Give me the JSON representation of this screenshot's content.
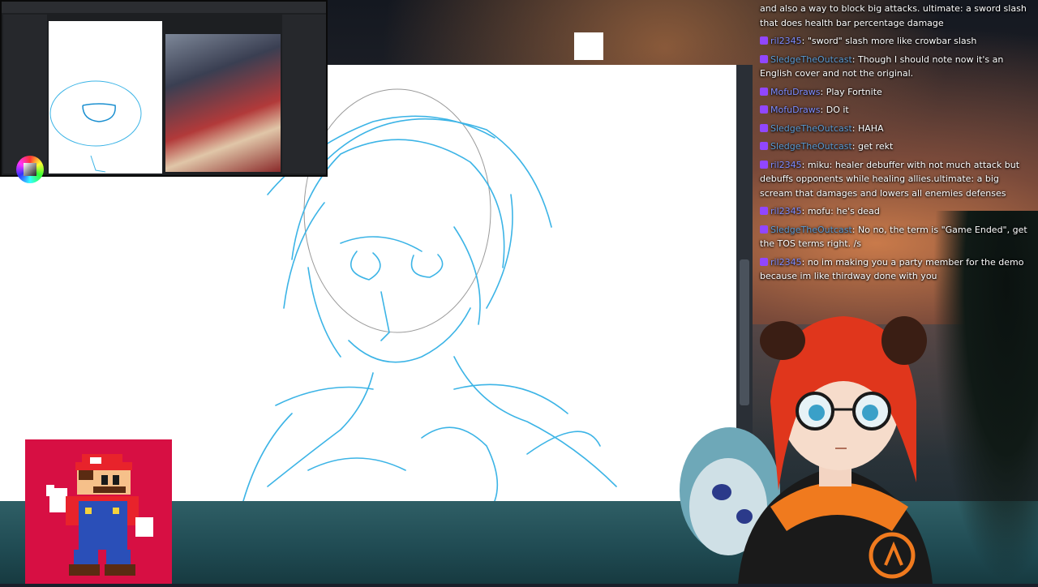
{
  "chat": {
    "messages": [
      {
        "user": "",
        "text": "and also a way to block big attacks. ultimate: a sword slash that does health bar percentage damage"
      },
      {
        "user": "ril2345",
        "text": "\"sword\" slash more like crowbar slash"
      },
      {
        "user": "SledgeTheOutcast",
        "text": "Though I should note now it's an English cover and not the original."
      },
      {
        "user": "MofuDraws",
        "text": "Play Fortnite"
      },
      {
        "user": "MofuDraws",
        "text": "DO it"
      },
      {
        "user": "SledgeTheOutcast",
        "text": "HAHA"
      },
      {
        "user": "SledgeTheOutcast",
        "text": "get rekt"
      },
      {
        "user": "ril2345",
        "text": "miku: healer debuffer with not much attack but debuffs opponents while healing allies.ultimate: a big scream that damages and lowers all enemies defenses"
      },
      {
        "user": "ril2345",
        "text": "mofu: he's dead"
      },
      {
        "user": "SledgeTheOutcast",
        "text": "No no, the term is \"Game Ended\", get the TOS terms right. /s"
      },
      {
        "user": "ril2345",
        "text": "no im making you a party member for the demo because im like thirdway done with you"
      }
    ],
    "separator": ": ",
    "badge_icon": "twitch-badge-icon",
    "colors": {
      "ril2345": "#7d8cff",
      "SledgeTheOutcast": "#5a9bd4",
      "MofuDraws": "#7d8cff",
      "badge": "#9146ff"
    }
  },
  "overlay": {
    "mario_box_color": "#d70f43",
    "canvas_background": "#ffffff",
    "sketch_stroke_color": "#3cb4e6"
  }
}
